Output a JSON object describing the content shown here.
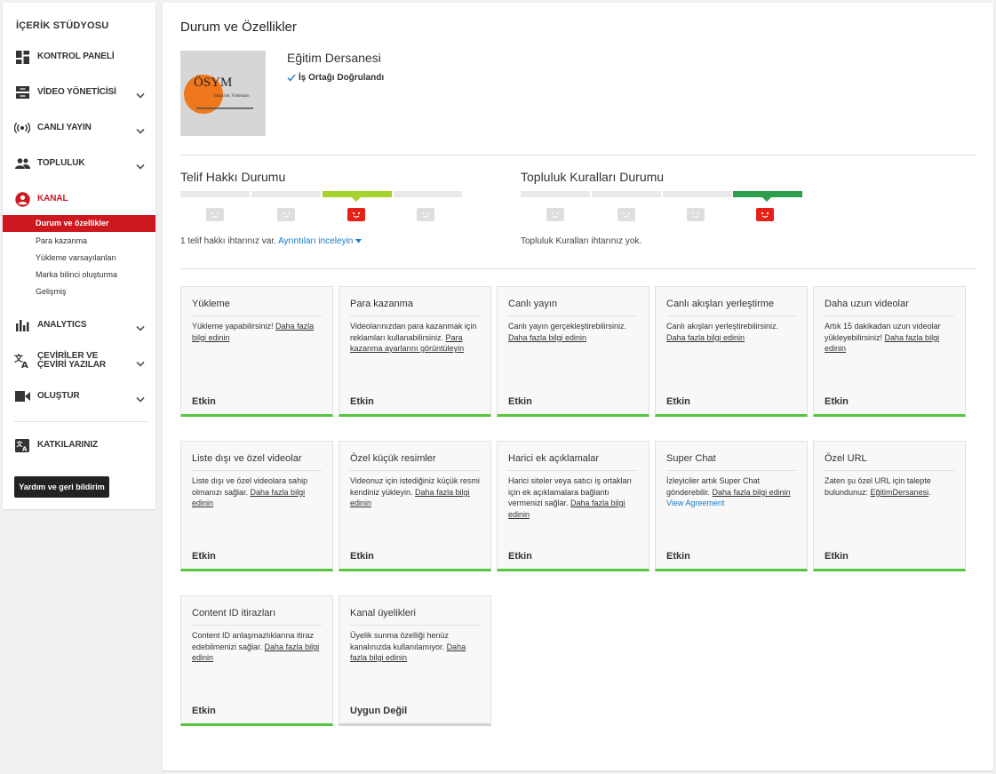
{
  "sidebar": {
    "studio_title": "İÇERİK STÜDYOSU",
    "items": [
      {
        "label": "KONTROL PANELİ",
        "icon": "dashboard-icon"
      },
      {
        "label": "VİDEO YÖNETİCİSİ",
        "icon": "video-manager-icon"
      },
      {
        "label": "CANLI YAYIN",
        "icon": "live-stream-icon"
      },
      {
        "label": "TOPLULUK",
        "icon": "community-icon"
      },
      {
        "label": "KANAL",
        "icon": "channel-icon"
      },
      {
        "label": "ANALYTICS",
        "icon": "analytics-icon"
      },
      {
        "label": "ÇEVİRİLER VE ÇEVİRİ YAZILAR",
        "icon": "translate-icon"
      },
      {
        "label": "OLUŞTUR",
        "icon": "create-icon"
      },
      {
        "label": "KATKILARINIZ",
        "icon": "contributions-icon"
      }
    ],
    "channel_sub": [
      "Durum ve özellikler",
      "Para kazanma",
      "Yükleme varsayılanları",
      "Marka bilinci oluşturma",
      "Gelişmiş"
    ],
    "help_button": "Yardım ve geri bildirim"
  },
  "main": {
    "page_title": "Durum ve Özellikler",
    "channel": {
      "name": "Eğitim Dersanesi",
      "verified": "İş Ortağı Doğrulandı",
      "avatar_text": "ÖSYM",
      "avatar_sub": "Hazırlık Videoları"
    },
    "copyright": {
      "title": "Telif Hakkı Durumu",
      "active_index": 2,
      "text": "1 telif hakkı ihtarınız var.",
      "link": "Ayrıntıları inceleyin"
    },
    "community": {
      "title": "Topluluk Kuralları Durumu",
      "active_index": 3,
      "text": "Topluluk Kuralları ihtarınız yok."
    },
    "cards": [
      {
        "title": "Yükleme",
        "desc": "Yükleme yapabilirsiniz! ",
        "link": "Daha fazla bilgi edinin",
        "status": "Etkin"
      },
      {
        "title": "Para kazanma",
        "desc": "Videolarınızdan para kazanmak için reklamları kullanabilirsiniz. ",
        "link": "Para kazanma ayarlarını görüntüleyin",
        "status": "Etkin"
      },
      {
        "title": "Canlı yayın",
        "desc": "Canlı yayın gerçekleştirebilirsiniz. ",
        "link": "Daha fazla bilgi edinin",
        "status": "Etkin"
      },
      {
        "title": "Canlı akışları yerleştirme",
        "desc": "Canlı akışları yerleştirebilirsiniz. ",
        "link": "Daha fazla bilgi edinin",
        "status": "Etkin"
      },
      {
        "title": "Daha uzun videolar",
        "desc": "Artık 15 dakikadan uzun videolar yükleyebilirsiniz! ",
        "link": "Daha fazla bilgi edinin",
        "status": "Etkin"
      },
      {
        "title": "Liste dışı ve özel videolar",
        "desc": "Liste dışı ve özel videolara sahip olmanızı sağlar. ",
        "link": "Daha fazla bilgi edinin",
        "status": "Etkin"
      },
      {
        "title": "Özel küçük resimler",
        "desc": "Videonuz için istediğiniz küçük resmi kendiniz yükleyin. ",
        "link": "Daha fazla bilgi edinin",
        "status": "Etkin"
      },
      {
        "title": "Harici ek açıklamalar",
        "desc": "Harici siteler veya satıcı iş ortakları için ek açıklamalara bağlantı vermenizi sağlar. ",
        "link": "Daha fazla bilgi edinin",
        "status": "Etkin"
      },
      {
        "title": "Super Chat",
        "desc": "İzleyiciler artık Super Chat gönderebilir. ",
        "link": "Daha fazla bilgi edinin",
        "extra": "View Agreement",
        "status": "Etkin"
      },
      {
        "title": "Özel URL",
        "desc": "Zaten şu özel URL için talepte bulundunuz: ",
        "link": "EğitimDersanesi",
        "tail": ".",
        "status": "Etkin"
      },
      {
        "title": "Content ID itirazları",
        "desc": "Content ID anlaşmazlıklarına itiraz edebilmenizi sağlar. ",
        "link": "Daha fazla bilgi edinin",
        "status": "Etkin"
      },
      {
        "title": "Kanal üyelikleri",
        "desc": "Üyelik sunma özelliği henüz kanalınızda kullanılamıyor. ",
        "link": "Daha fazla bilgi edinin",
        "status": "Uygun Değil"
      }
    ]
  },
  "colors": {
    "brand_red": "#cc181e",
    "link_blue": "#167ac6",
    "enabled_green": "#55c53d",
    "copyright_bar": "#a5d22d",
    "community_bar": "#2d9e4b"
  }
}
